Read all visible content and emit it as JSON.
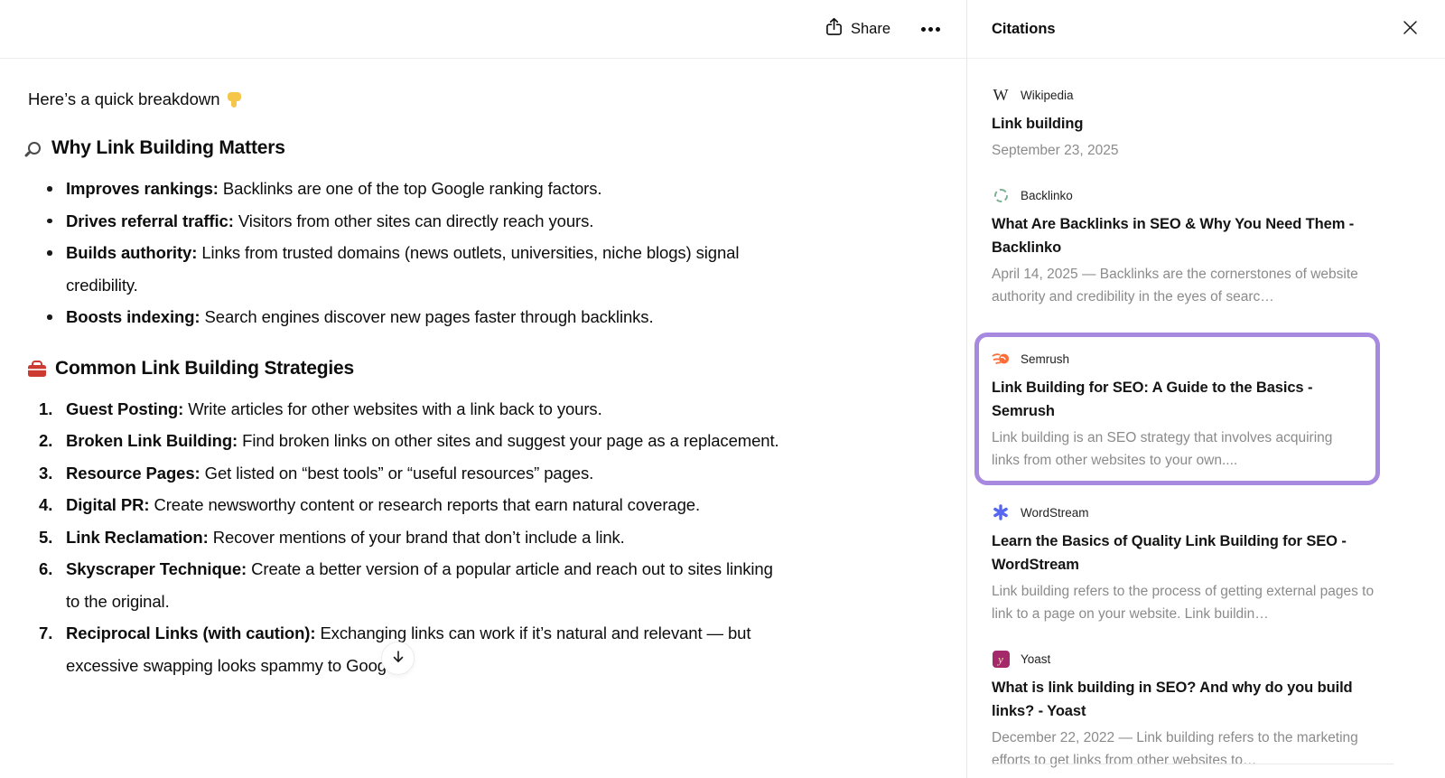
{
  "header": {
    "share_label": "Share"
  },
  "content": {
    "intro": "Here’s a quick breakdown",
    "intro_emoji": "👇",
    "sections": [
      {
        "emoji": "🔍",
        "heading": "Why Link Building Matters",
        "items": [
          {
            "lead": "Improves rankings:",
            "text": "Backlinks are one of the top Google ranking factors."
          },
          {
            "lead": "Drives referral traffic:",
            "text": "Visitors from other sites can directly reach yours."
          },
          {
            "lead": "Builds authority:",
            "text": "Links from trusted domains (news outlets, universities, niche blogs) signal credibility."
          },
          {
            "lead": "Boosts indexing:",
            "text": "Search engines discover new pages faster through backlinks."
          }
        ]
      },
      {
        "emoji": "🧰",
        "heading": "Common Link Building Strategies",
        "items": [
          {
            "lead": "Guest Posting:",
            "text": "Write articles for other websites with a link back to yours."
          },
          {
            "lead": "Broken Link Building:",
            "text": "Find broken links on other sites and suggest your page as a replacement."
          },
          {
            "lead": "Resource Pages:",
            "text": "Get listed on “best tools” or “useful resources” pages."
          },
          {
            "lead": "Digital PR:",
            "text": "Create newsworthy content or research reports that earn natural coverage."
          },
          {
            "lead": "Link Reclamation:",
            "text": "Recover mentions of your brand that don’t include a link."
          },
          {
            "lead": "Skyscraper Technique:",
            "text": "Create a better version of a popular article and reach out to sites linking to the original."
          },
          {
            "lead": "Reciprocal Links (with caution):",
            "text": "Exchanging links can work if it’s natural and relevant — but excessive swapping looks spammy to Google."
          }
        ]
      }
    ]
  },
  "citations": {
    "title": "Citations",
    "items": [
      {
        "source": "Wikipedia",
        "icon": "wikipedia-logo",
        "icon_glyph": "W",
        "title": "Link building",
        "snippet": "September 23, 2025",
        "highlighted": false
      },
      {
        "source": "Backlinko",
        "icon": "backlinko-logo",
        "title": "What Are Backlinks in SEO & Why You Need Them - Backlinko",
        "snippet": "April 14, 2025 — Backlinks are the cornerstones of website authority and credibility in the eyes of searc…",
        "highlighted": false
      },
      {
        "source": "Semrush",
        "icon": "semrush-logo",
        "title": "Link Building for SEO: A Guide to the Basics - Semrush",
        "snippet": "Link building is an SEO strategy that involves acquiring links from other websites to your own....",
        "highlighted": true
      },
      {
        "source": "WordStream",
        "icon": "wordstream-logo",
        "title": "Learn the Basics of Quality Link Building for SEO - WordStream",
        "snippet": "Link building refers to the process of getting external pages to link to a page on your website. Link buildin…",
        "highlighted": false
      },
      {
        "source": "Yoast",
        "icon": "yoast-logo",
        "icon_glyph": "y",
        "title": "What is link building in SEO? And why do you build links? - Yoast",
        "snippet": "December 22, 2022 — Link building refers to the marketing efforts to get links from other websites to…",
        "highlighted": false
      }
    ]
  },
  "colors": {
    "highlight_border": "#a78ae0",
    "semrush_orange": "#ff6c36",
    "wordstream_blue": "#5766ee",
    "yoast_magenta": "#a4286a",
    "backlinko_green": "#7db093"
  }
}
